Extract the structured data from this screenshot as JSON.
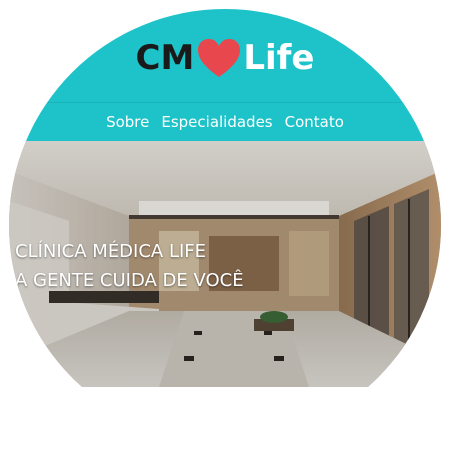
{
  "brand": {
    "logo_cm": "CM",
    "logo_life": "Life",
    "heart_icon": "heart-icon",
    "colors": {
      "teal": "#1ec3c9",
      "heart_red": "#e8474e",
      "dark_text": "#1a1a1a"
    }
  },
  "nav": {
    "items": [
      {
        "label": "Sobre"
      },
      {
        "label": "Especialidades"
      },
      {
        "label": "Contato"
      }
    ]
  },
  "hero": {
    "title_line1": "CLÍNICA MÉDICA LIFE",
    "title_line2": "A GENTE CUIDA DE VOCÊ"
  }
}
